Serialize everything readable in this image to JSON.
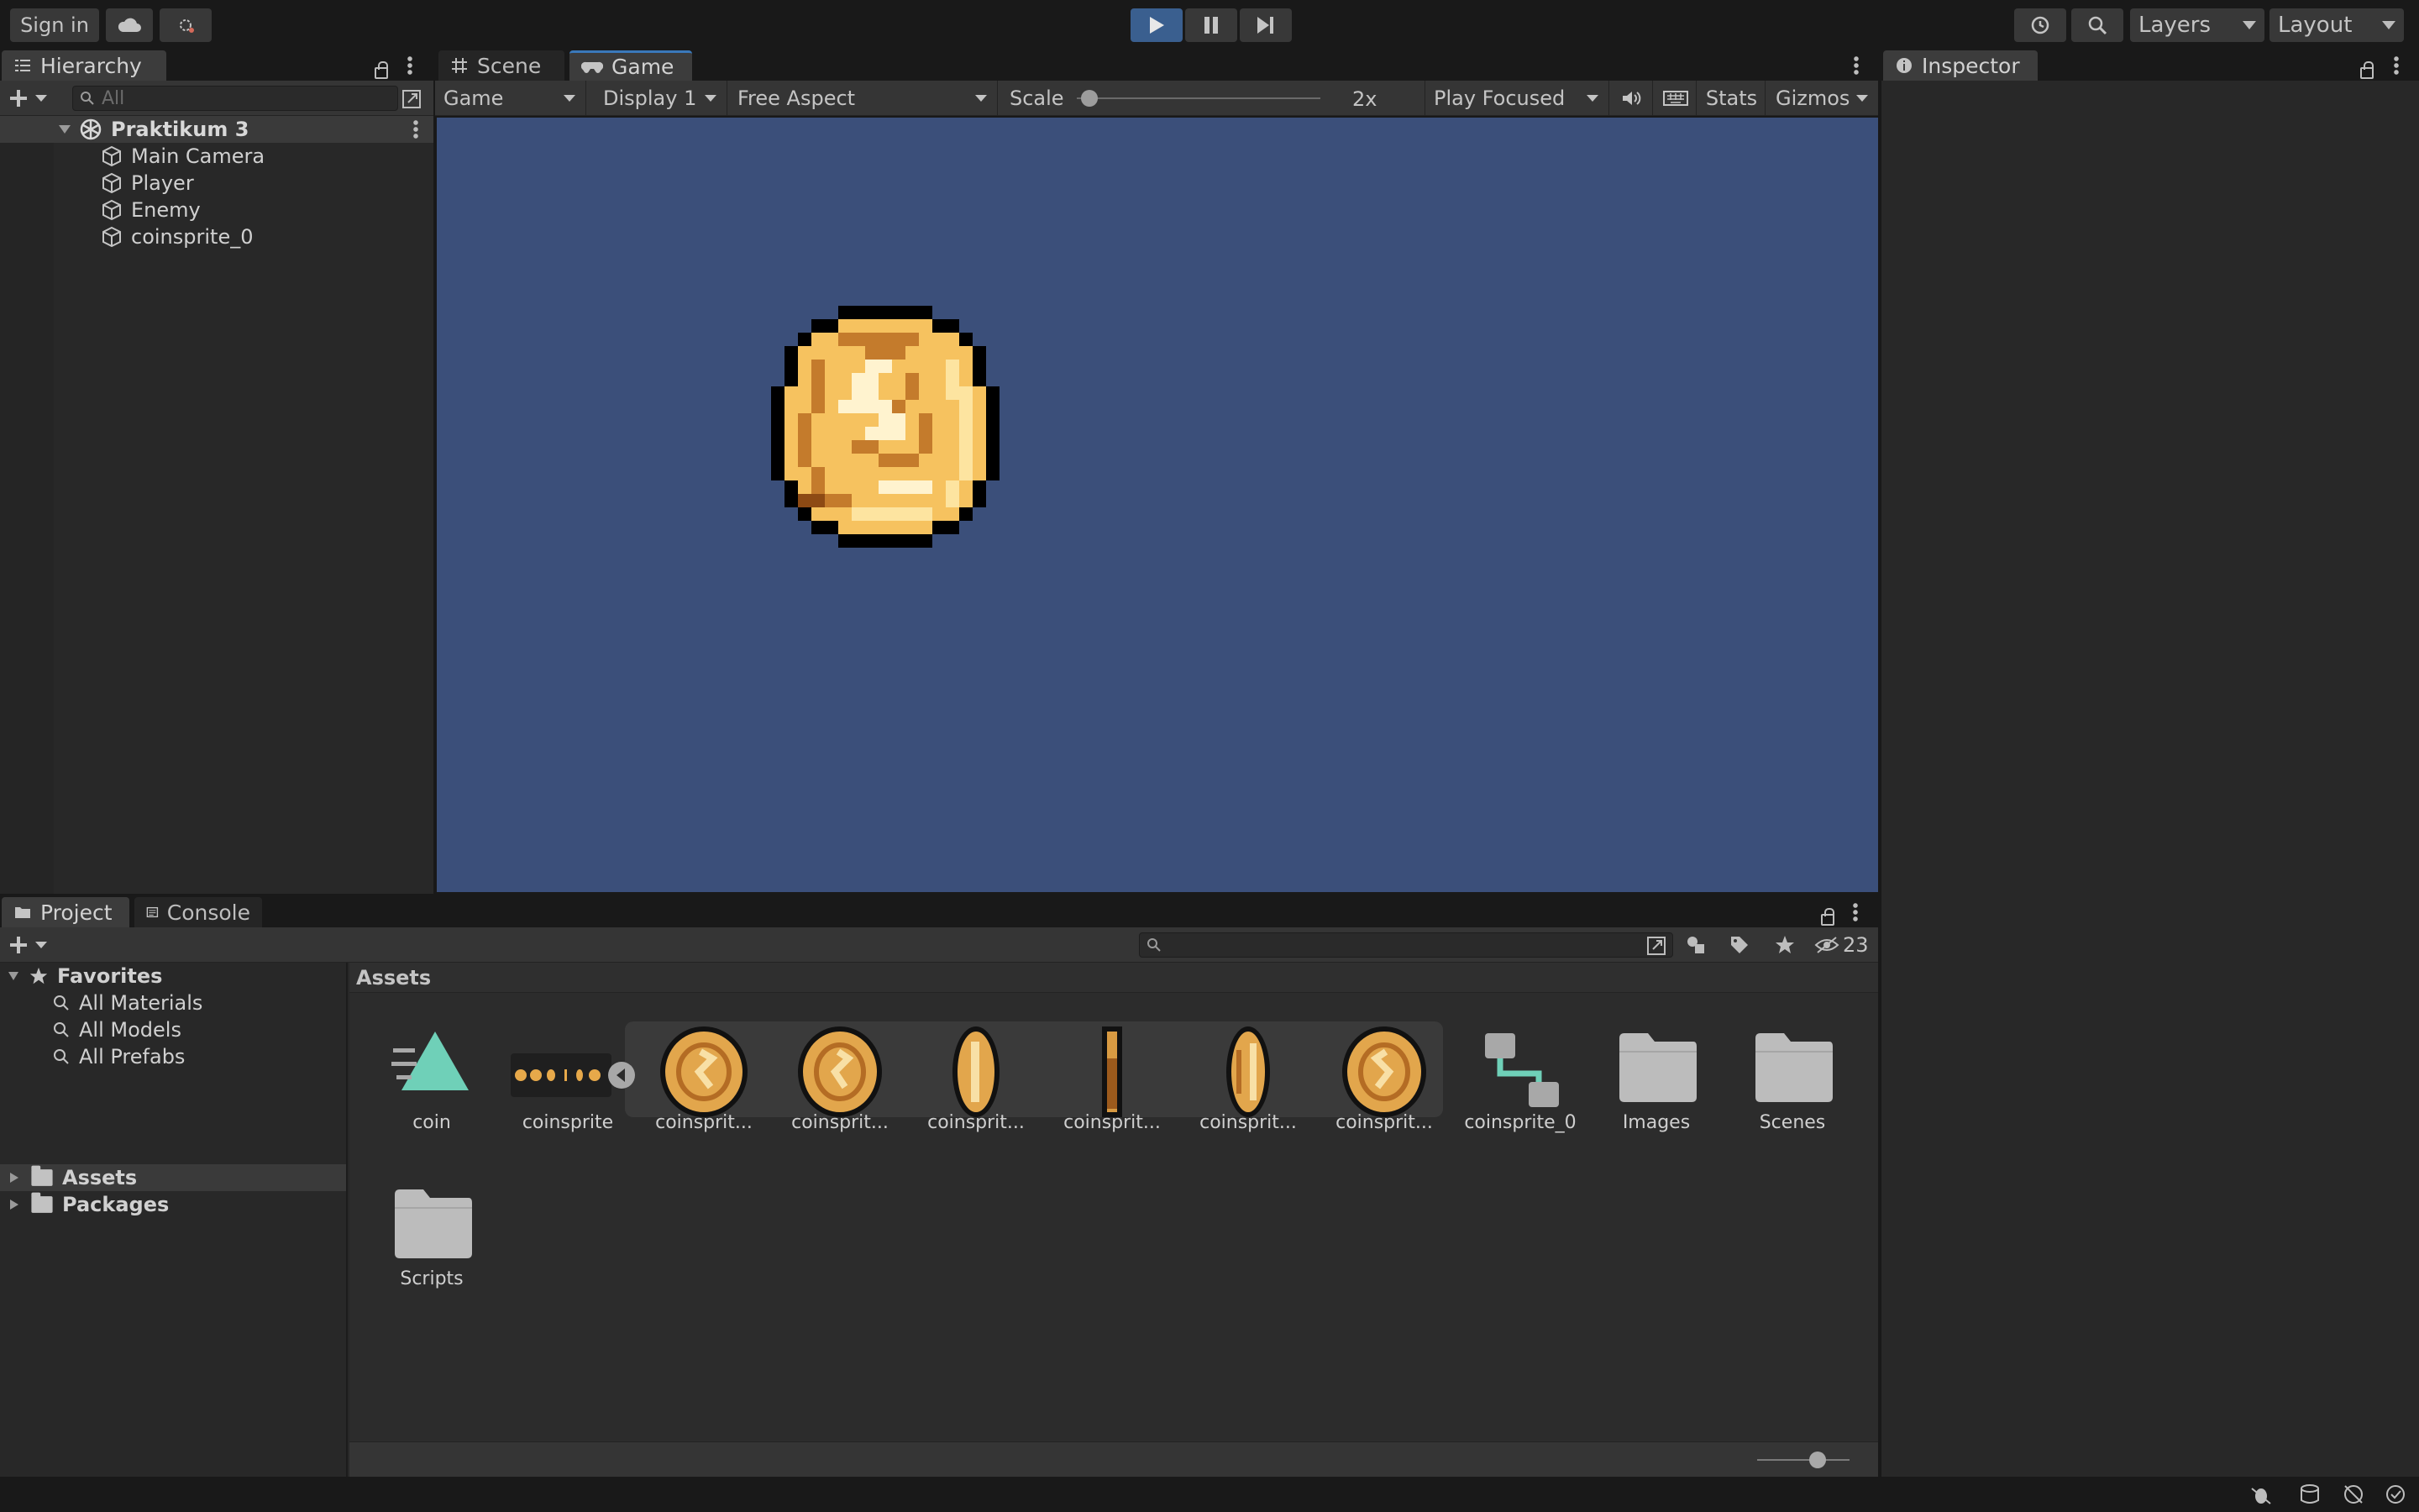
{
  "toolbar": {
    "sign_in": "Sign in",
    "layers_label": "Layers",
    "layout_label": "Layout"
  },
  "hierarchy": {
    "tab_label": "Hierarchy",
    "search_placeholder": "All",
    "scene_name": "Praktikum 3",
    "items": [
      "Main Camera",
      "Player",
      "Enemy",
      "coinsprite_0"
    ]
  },
  "game_view": {
    "tabs": [
      "Scene",
      "Game"
    ],
    "mode": "Game",
    "display": "Display 1",
    "aspect": "Free Aspect",
    "scale_label": "Scale",
    "scale_value": "2x",
    "scale_level": 0.02,
    "play_mode": "Play Focused",
    "stats": "Stats",
    "gizmos": "Gizmos",
    "background_color": "#3b4f7a"
  },
  "inspector": {
    "tab_label": "Inspector"
  },
  "project": {
    "tabs": [
      "Project",
      "Console"
    ],
    "hidden_count": "23",
    "breadcrumb": "Assets",
    "favorites_label": "Favorites",
    "favorites": [
      "All Materials",
      "All Models",
      "All Prefabs"
    ],
    "roots": [
      "Assets",
      "Packages"
    ],
    "assets": [
      {
        "label": "coin",
        "icon": "animation-clip-icon"
      },
      {
        "label": "coinsprite",
        "icon": "sprite-sheet-icon"
      },
      {
        "label": "coinsprit...",
        "icon": "coin-frame-icon"
      },
      {
        "label": "coinsprit...",
        "icon": "coin-frame-icon"
      },
      {
        "label": "coinsprit...",
        "icon": "coin-frame-icon"
      },
      {
        "label": "coinsprit...",
        "icon": "coin-frame-icon"
      },
      {
        "label": "coinsprit...",
        "icon": "coin-frame-icon"
      },
      {
        "label": "coinsprit...",
        "icon": "coin-frame-icon"
      },
      {
        "label": "coinsprite_0",
        "icon": "animator-controller-icon"
      },
      {
        "label": "Images",
        "icon": "folder-icon"
      },
      {
        "label": "Scenes",
        "icon": "folder-icon"
      },
      {
        "label": "Scripts",
        "icon": "folder-icon"
      }
    ]
  },
  "colors": {
    "accent": "#3a5f8f",
    "coin_gold": "#f6c25f",
    "animation_teal": "#6fd0b8"
  }
}
